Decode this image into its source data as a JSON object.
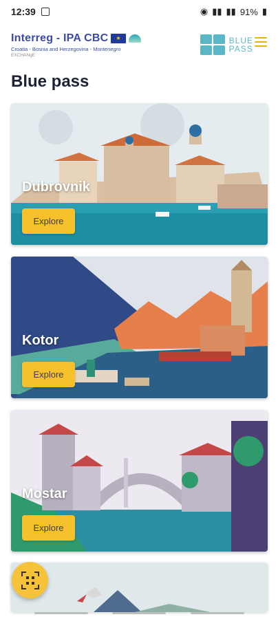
{
  "status_bar": {
    "time": "12:39",
    "battery": "91%"
  },
  "header": {
    "logo_title": "Interreg - IPA CBC",
    "logo_subtitle": "Croatia - Bosnia and Herzegovina - Montenegro",
    "logo_tag": "EXCHANgE",
    "partner_logo_line1": "BLUE",
    "partner_logo_line2": "PASS"
  },
  "page": {
    "title": "Blue pass"
  },
  "cards": [
    {
      "title": "Dubrovnik",
      "button": "Explore"
    },
    {
      "title": "Kotor",
      "button": "Explore"
    },
    {
      "title": "Mostar",
      "button": "Explore"
    }
  ],
  "colors": {
    "accent": "#f6c12a",
    "title_blue": "#3a4aa8",
    "blue_pass": "#5ab7c5"
  },
  "icons": {
    "menu": "hamburger-menu-icon",
    "fab": "qr-code-scanner-icon"
  }
}
